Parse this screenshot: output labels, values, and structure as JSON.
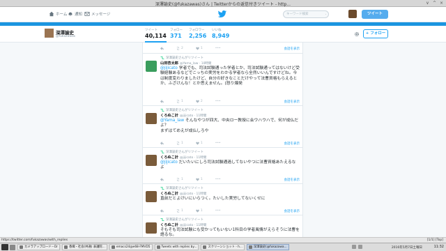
{
  "window": {
    "title": "深澤諭史(@fukazawas)さん | Twitterからの返信付きツイート - http...",
    "controls": [
      "∨",
      "^",
      "×"
    ]
  },
  "nav": {
    "home_label": "ホーム",
    "notifications_label": "通知",
    "messages_label": "メッセージ",
    "search_placeholder": "キーワード検索",
    "tweet_button_label": "ツイート"
  },
  "profile": {
    "name": "深澤諭史",
    "handle": "@fukazawas",
    "follow_label": "フォロー",
    "stats": [
      {
        "label": "ツイート",
        "value": "40,114"
      },
      {
        "label": "フォロー",
        "value": "371"
      },
      {
        "label": "フォロワー",
        "value": "2,256"
      },
      {
        "label": "いいね",
        "value": "8,949"
      }
    ]
  },
  "tweets": [
    {
      "partial": true,
      "rt_count": "2",
      "like_count": "1",
      "show_conversation": "会話を表示"
    },
    {
      "retweeted_by": "深澤諭史さんがリツイート",
      "name": "山田杏太郎",
      "handle": "@Yama_law · 10時間",
      "mention": "@jijicato",
      "text": " 学者でも、司法試験通った学者とか、司法試験通ってはないけど受験経験あるなどでこっちの実労をわかる学者なら全然いいんですけどね。今は制度変わりましたけど、自分の好きなことだけやって法曹資格もらえるとか、ふざけんな！とか思えません。(怒り爆発",
      "rt_count": "1",
      "like_count": "2",
      "show_conversation": "会話を表示"
    },
    {
      "retweeted_by": "深澤諭史さんがリツイート",
      "name": "くろぬこ計",
      "handle": "@jijicato · 11時間",
      "mention": "@Yama_law",
      "text": " そんなやつが四大、中央ロー教授に会ウハウハで、何が成仏だよ？\nまずはてめえが成仏しろや",
      "rt_count": "1",
      "like_count": "1",
      "show_conversation": "会話を表示"
    },
    {
      "retweeted_by": "深澤諭史さんがリツイート",
      "name": "くろぬこ計",
      "handle": "@jijicato · 11時間",
      "mention": "@jijicato",
      "text": " だいたいにしろ司法試験通過してないやつに法曹資格あたえるなよ",
      "rt_count": "1",
      "like_count": "1",
      "show_conversation": "会話を表示"
    },
    {
      "retweeted_by": "深澤諭史さんがリツイート",
      "name": "くろぬこ計",
      "handle": "@jijicato · 11時間",
      "mention": "",
      "text": "直前だとよけいにいらつく。たいした実労してないくせに",
      "rt_count": "1",
      "like_count": "1",
      "show_conversation": "会話を表示"
    },
    {
      "retweeted_by": "深澤諭史さんがリツイート",
      "name": "くろぬこ計",
      "handle": "@jijicato · 11時間",
      "mention": "",
      "text": "そもそも司法試験にも受かってもいない1科目の学者風情がえらそうに法曹を語るな。",
      "rt_count": "",
      "like_count": "",
      "show_conversation": ""
    }
  ],
  "status_bar": {
    "url": "https://twitter.com/fukazawas/with_replies",
    "info": "[1/1] [Top]"
  },
  "taskbar": {
    "tasks": [
      "カメラアップロード－Dr",
      "香織・社会(共通) 表議院...",
      "emacs24@e68-FMVD5",
      "Tweets with replies by...",
      "スクリーンショット - h...",
      "深澤諭史(@fukazawa..."
    ],
    "date": "2016年5月7日土曜日",
    "time": "11:32"
  },
  "colors": {
    "brand_blue": "#1da1f2",
    "header_blue": "#1b95e0",
    "tweet_button": "#55acee"
  }
}
